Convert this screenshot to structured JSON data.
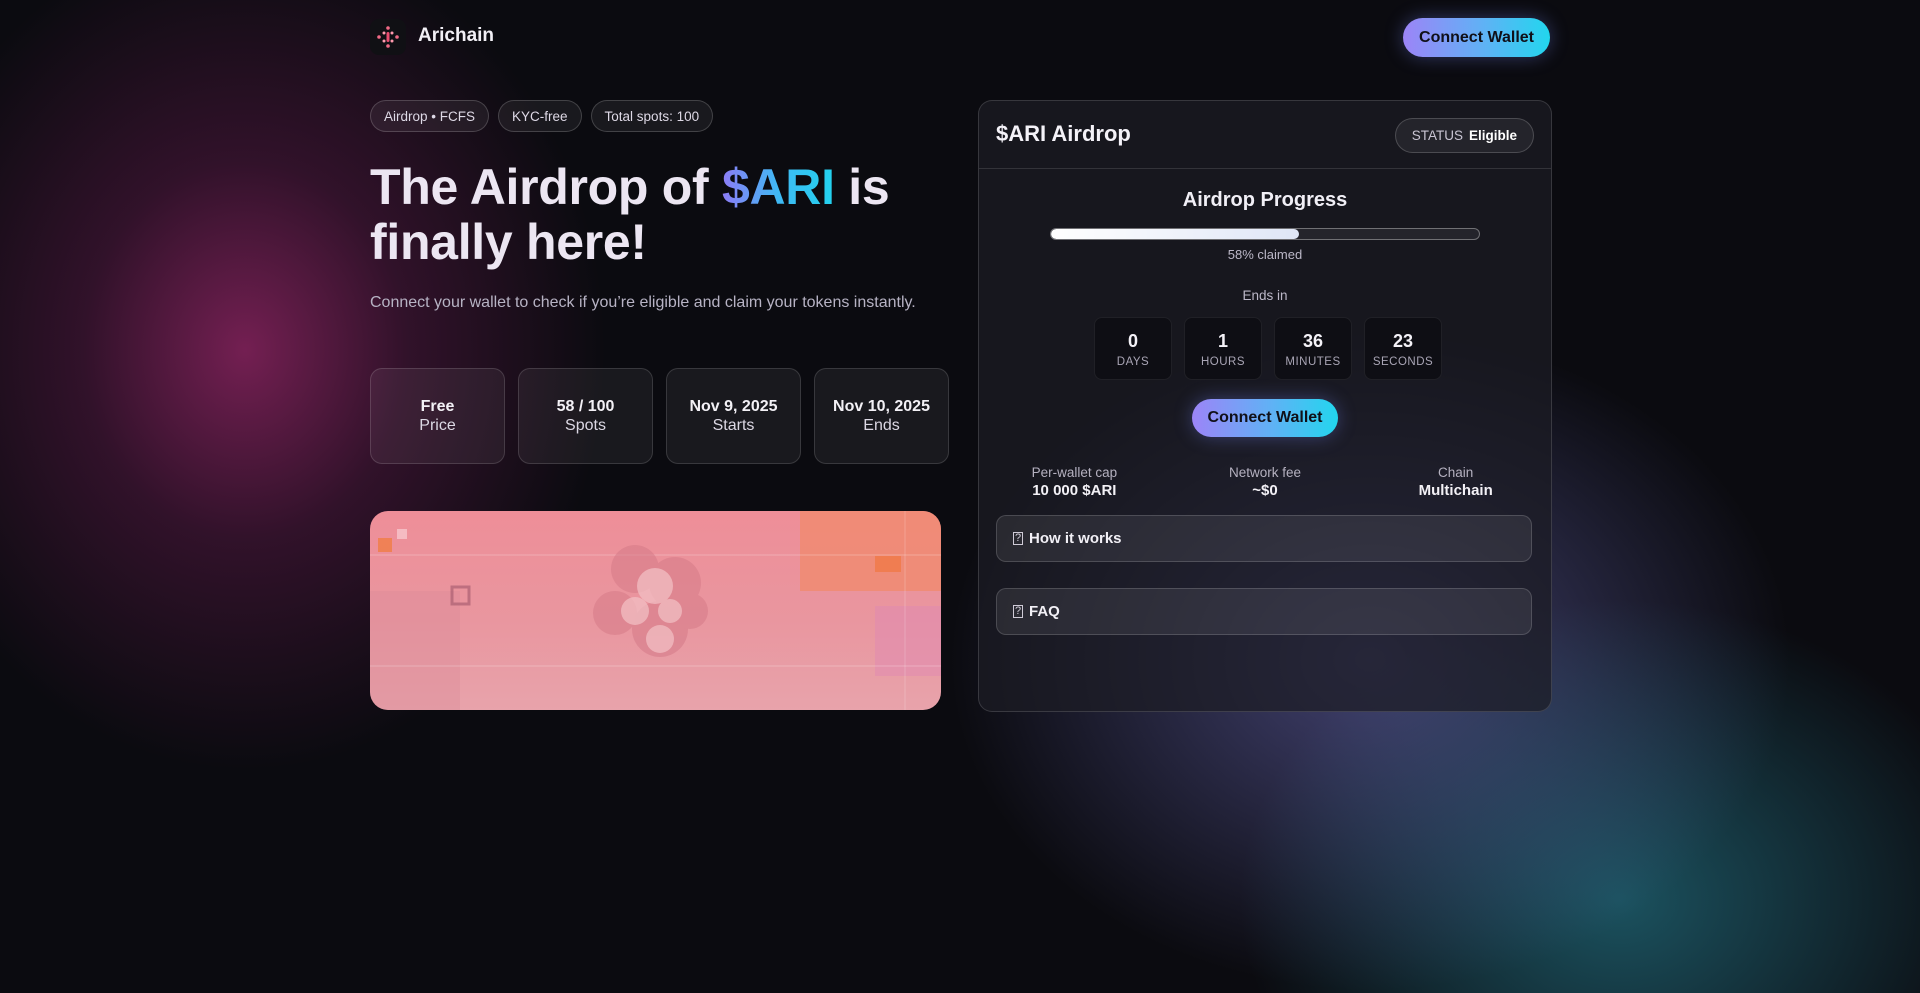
{
  "header": {
    "brand": "Arichain",
    "connect_label": "Connect Wallet"
  },
  "pills": [
    "Airdrop • FCFS",
    "KYC-free",
    "Total spots: 100"
  ],
  "hero": {
    "title_before": "The Airdrop of ",
    "title_highlight": "$ARI",
    "title_after": " is finally here!",
    "subtitle": "Connect your wallet to check if you’re eligible and claim your tokens instantly."
  },
  "stats": [
    {
      "value": "Free",
      "label": "Price"
    },
    {
      "value": "58 / 100",
      "label": "Spots"
    },
    {
      "value": "Nov 9, 2025",
      "label": "Starts"
    },
    {
      "value": "Nov 10, 2025",
      "label": "Ends"
    }
  ],
  "card": {
    "title": "$ARI Airdrop",
    "status_key": "STATUS",
    "status_value": "Eligible",
    "progress_title": "Airdrop Progress",
    "progress_fraction": 0.58,
    "progress_label": "58% claimed",
    "ends_in_label": "Ends in",
    "countdown": [
      {
        "value": "0",
        "unit": "DAYS"
      },
      {
        "value": "1",
        "unit": "HOURS"
      },
      {
        "value": "36",
        "unit": "MINUTES"
      },
      {
        "value": "23",
        "unit": "SECONDS"
      }
    ],
    "connect_label": "Connect Wallet",
    "meta": [
      {
        "key": "Per-wallet cap",
        "value": "10 000 $ARI"
      },
      {
        "key": "Network fee",
        "value": "~$0"
      },
      {
        "key": "Chain",
        "value": "Multichain"
      }
    ],
    "accordions": [
      {
        "icon": "?",
        "label": "How it works"
      },
      {
        "icon": "?",
        "label": "FAQ"
      }
    ]
  },
  "colors": {
    "accent_start": "#9c84f7",
    "accent_end": "#22d6ee",
    "background": "#0b0b10",
    "banner_pink": "#ee8e98"
  }
}
